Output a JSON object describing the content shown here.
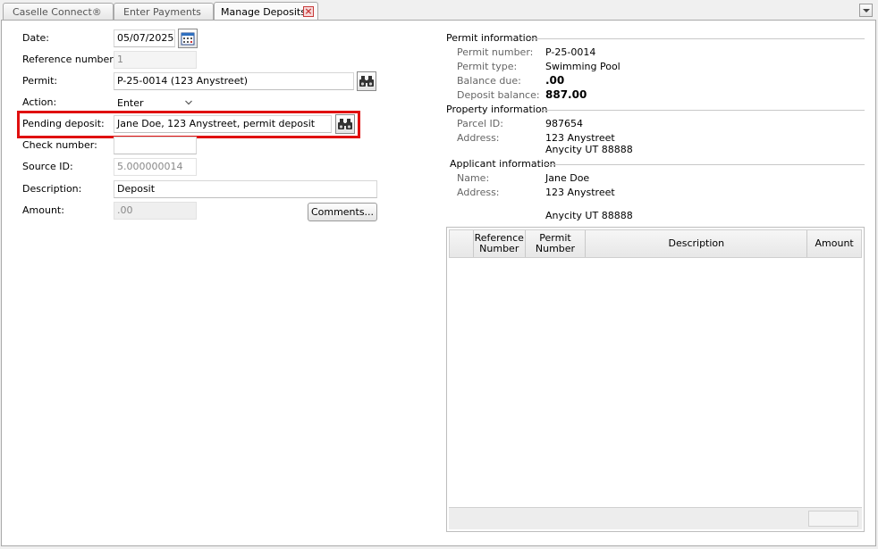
{
  "tabs": [
    {
      "label": "Caselle Connect®"
    },
    {
      "label": "Enter Payments"
    },
    {
      "label": "Manage Deposits"
    }
  ],
  "form": {
    "date_label": "Date:",
    "date_value": "05/07/2025",
    "reference_label": "Reference number:",
    "reference_value": "1",
    "permit_label": "Permit:",
    "permit_value": "P-25-0014 (123 Anystreet)",
    "action_label": "Action:",
    "action_value": "Enter",
    "pending_label": "Pending deposit:",
    "pending_value": "Jane Doe, 123 Anystreet, permit deposit",
    "check_label": "Check number:",
    "check_value": "",
    "source_label": "Source ID:",
    "source_value": "5.000000014",
    "description_label": "Description:",
    "description_value": "Deposit",
    "amount_label": "Amount:",
    "amount_value": ".00",
    "comments_button": "Comments..."
  },
  "permit_info": {
    "title": "Permit information",
    "number_label": "Permit number:",
    "number_value": "P-25-0014",
    "type_label": "Permit type:",
    "type_value": "Swimming Pool",
    "balance_label": "Balance due:",
    "balance_value": ".00",
    "deposit_label": "Deposit balance:",
    "deposit_value": "887.00"
  },
  "property_info": {
    "title": "Property information",
    "parcel_label": "Parcel ID:",
    "parcel_value": "987654",
    "address_label": "Address:",
    "address_line1": "123 Anystreet",
    "address_line2": "Anycity UT 88888"
  },
  "applicant_info": {
    "title": "Applicant information",
    "name_label": "Name:",
    "name_value": "Jane Doe",
    "address_label": "Address:",
    "address_line1": "123 Anystreet",
    "address_line2": "Anycity UT 88888"
  },
  "grid": {
    "columns": [
      "",
      "Reference Number",
      "Permit Number",
      "Description",
      "Amount"
    ],
    "rows": []
  },
  "colors": {
    "highlight": "#e01010",
    "panel_border": "#a9a9a9"
  }
}
